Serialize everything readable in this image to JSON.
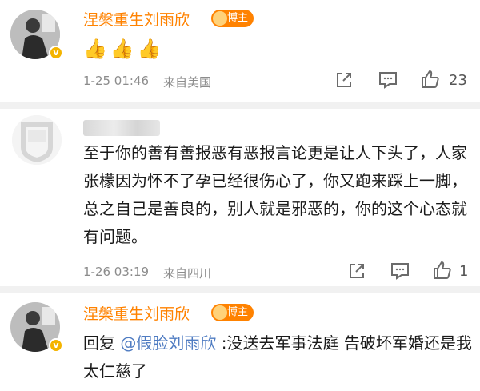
{
  "comments": [
    {
      "user": "涅槃重生刘雨欣",
      "badge": "博主",
      "verified_mark": "v",
      "emoji": "👍👍👍",
      "time": "1-25 01:46",
      "location": "来自美国",
      "likes": "23"
    },
    {
      "user_hidden": true,
      "text": "至于你的善有善报恶有恶报言论更是让人下头了，人家张檬因为怀不了孕已经很伤心了，你又跑来踩上一脚，总之自己是善良的，别人就是邪恶的，你的这个心态就有问题。",
      "time": "1-26 03:19",
      "location": "来自四川",
      "likes": "1"
    },
    {
      "user": "涅槃重生刘雨欣",
      "badge": "博主",
      "verified_mark": "v",
      "reply_prefix": "回复",
      "mention": "@假脸刘雨欣",
      "text": ":没送去军事法庭 告破坏军婚还是我太仁慈了"
    }
  ],
  "icons": [
    "share-icon",
    "comment-icon",
    "like-icon"
  ],
  "colors": {
    "username": "#ff8200",
    "mention": "#4f7cc2",
    "meta": "#8c8c8c"
  }
}
